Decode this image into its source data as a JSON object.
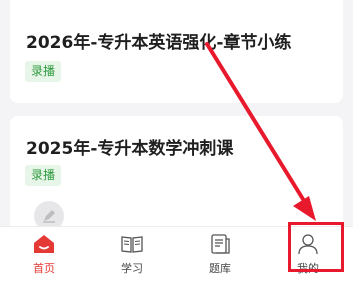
{
  "courses": [
    {
      "title": "2026年-专升本英语强化-章节小练",
      "badge": "录播"
    },
    {
      "title": "2025年-专升本数学冲刺课",
      "badge": "录播"
    }
  ],
  "tabbar": {
    "items": [
      {
        "label": "首页",
        "icon": "home-icon",
        "active": true
      },
      {
        "label": "学习",
        "icon": "book-icon",
        "active": false
      },
      {
        "label": "题库",
        "icon": "question-bank-icon",
        "active": false
      },
      {
        "label": "我的",
        "icon": "profile-icon",
        "active": false
      }
    ]
  },
  "annotation": {
    "color": "#e8192c"
  },
  "colors": {
    "accent": "#e53935",
    "badge_text": "#2f9b3f",
    "badge_bg": "#e8f6ea"
  }
}
